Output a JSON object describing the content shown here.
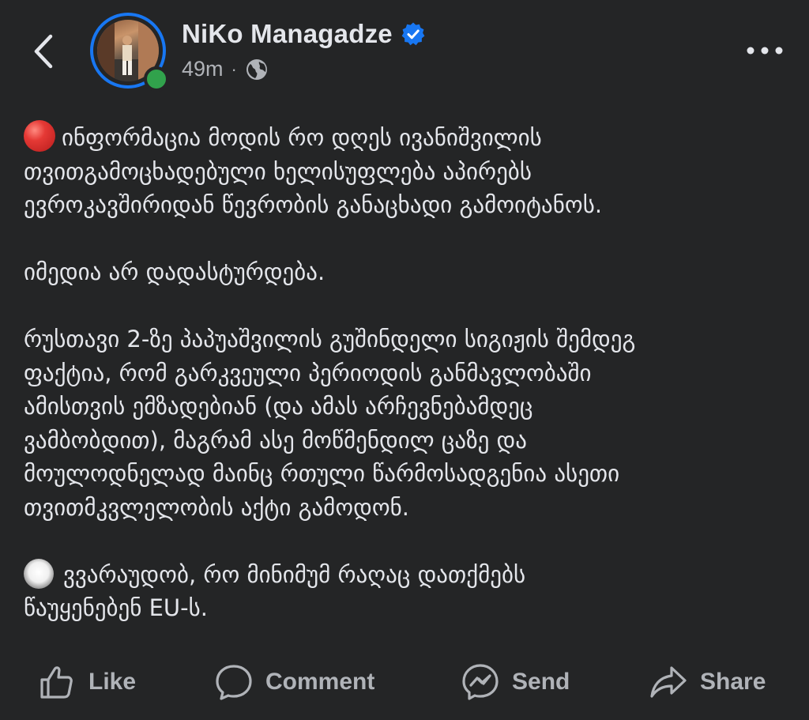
{
  "author": {
    "name": "NiKo Managadze",
    "time": "49m",
    "separator": "·"
  },
  "post": {
    "paragraph1": "ინფორმაცია მოდის რო დღეს ივანიშვილის\nთვითგამოცხადებული ხელისუფლება აპირებს\nევროკავშირიდან წევრობის განაცხადი გამოიტანოს.",
    "paragraph2": "იმედია არ დადასტურდება.",
    "paragraph3": "რუსთავი 2-ზე პაპუაშვილის გუშინდელი სიგიჟის შემდეგ\nფაქტია, რომ გარკვეული პერიოდის განმავლობაში\nამისთვის ემზადებიან (და ამას არჩევნებამდეც\nვამბობდით), მაგრამ ასე მოწმენდილ ცაზე და\nმოულოდნელად მაინც რთული წარმოსადგენია ასეთი\nთვითმკვლელობის აქტი გამოდონ.",
    "paragraph4": "ვვარაუდობ, რო მინიმუმ რაღაც დათქმებს\nწაუყენებენ EU-ს."
  },
  "actions": {
    "like": "Like",
    "comment": "Comment",
    "send": "Send",
    "share": "Share"
  },
  "icons": {
    "back": "chevron-left-icon",
    "verified": "verified-badge-icon",
    "privacy": "globe-icon",
    "more": "more-horizontal-icon",
    "red_circle": "red-circle-emoji",
    "white_circle": "white-circle-emoji"
  },
  "colors": {
    "background": "#242526",
    "text": "#e4e6eb",
    "secondary": "#b0b3b8",
    "accent": "#1877f2",
    "online": "#31a24c"
  }
}
